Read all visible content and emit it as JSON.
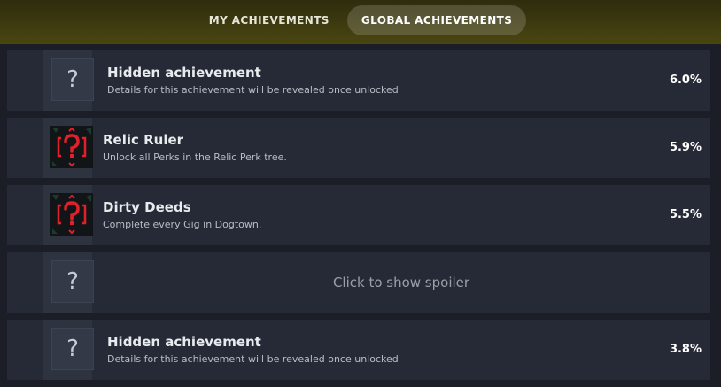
{
  "tabs": [
    {
      "label": "MY ACHIEVEMENTS",
      "active": false
    },
    {
      "label": "GLOBAL ACHIEVEMENTS",
      "active": true
    }
  ],
  "icon_glyph": "?",
  "rows": [
    {
      "type": "hidden",
      "name": "Hidden achievement",
      "description": "Details for this achievement will be revealed once unlocked",
      "percent": "6.0%",
      "icon": "question-icon"
    },
    {
      "type": "unlocked",
      "name": "Relic Ruler",
      "description": "Unlock all Perks in the Relic Perk tree.",
      "percent": "5.9%",
      "icon": "relic-ruler-icon"
    },
    {
      "type": "unlocked",
      "name": "Dirty Deeds",
      "description": "Complete every Gig in Dogtown.",
      "percent": "5.5%",
      "icon": "dirty-deeds-icon"
    },
    {
      "type": "spoiler",
      "text": "Click to show spoiler",
      "icon": "question-icon"
    },
    {
      "type": "hidden",
      "name": "Hidden achievement",
      "description": "Details for this achievement will be revealed once unlocked",
      "percent": "3.8%",
      "icon": "question-icon"
    }
  ],
  "colors": {
    "accent_icon": "#e0202a",
    "header": "#4a4612",
    "row_bg": "#262a36"
  }
}
